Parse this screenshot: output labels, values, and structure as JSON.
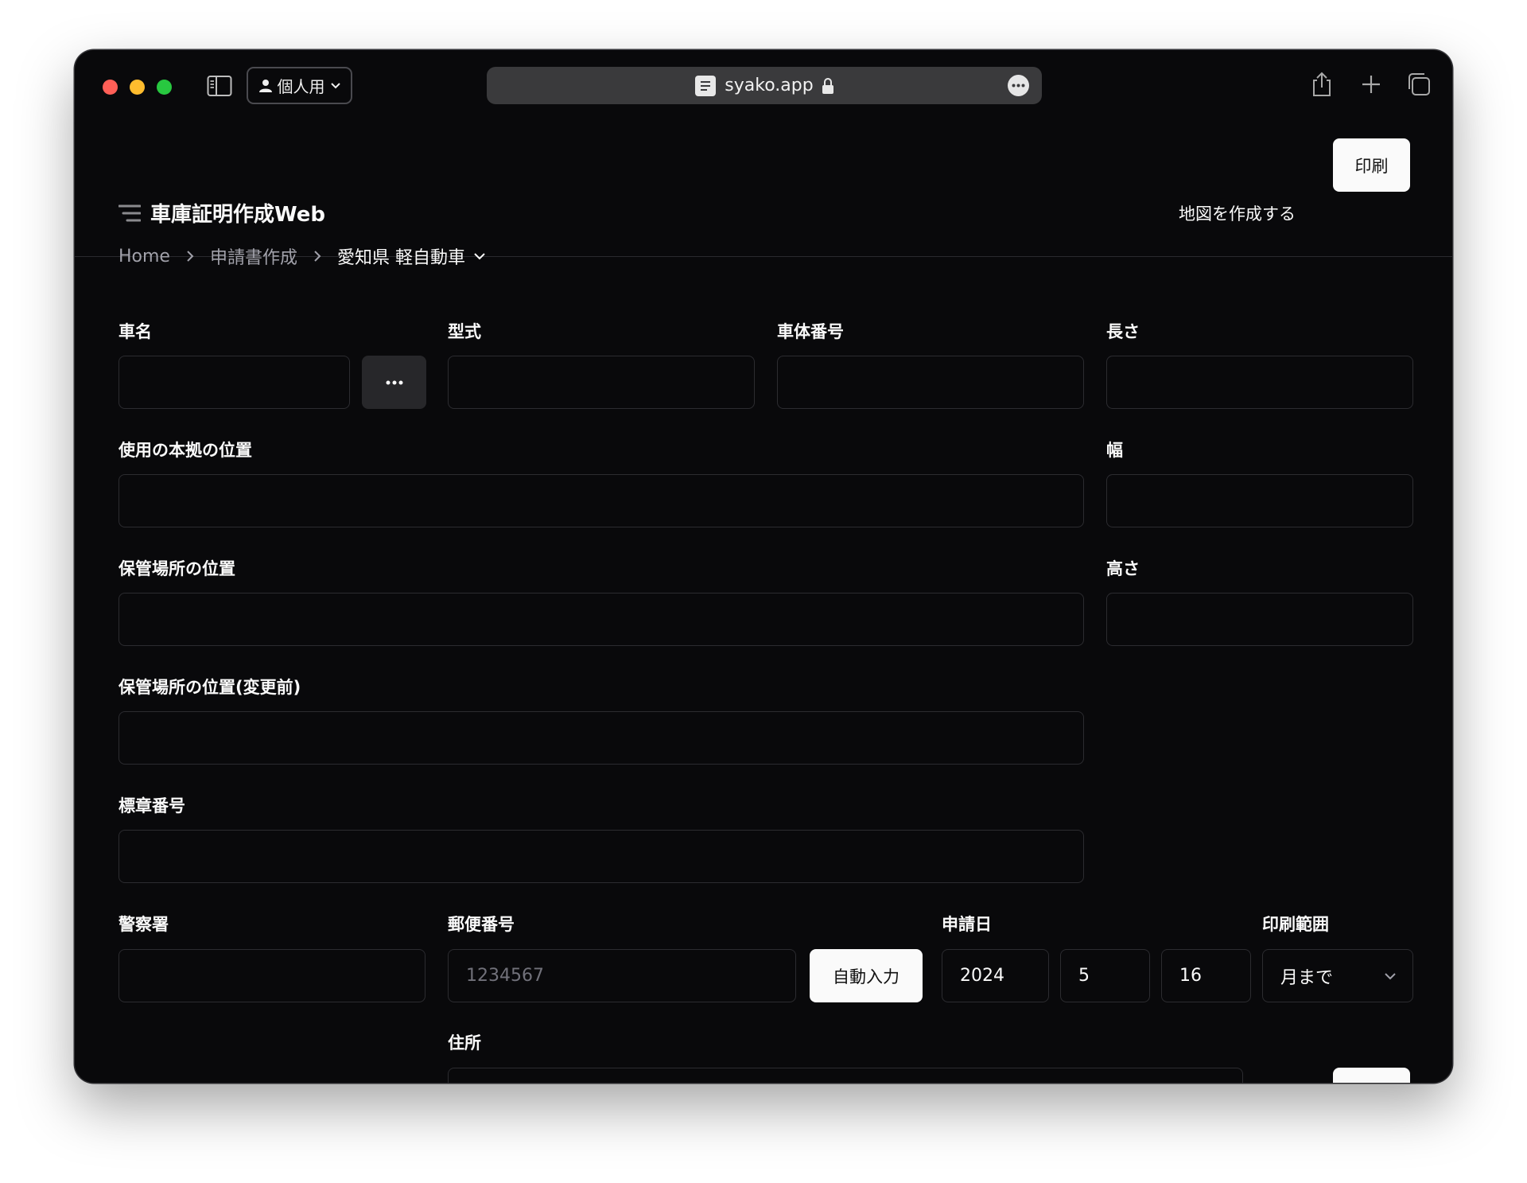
{
  "browser": {
    "profile_label": "個人用",
    "url": "syako.app"
  },
  "header": {
    "title": "車庫証明作成Web",
    "map_link": "地図を作成する",
    "print_button": "印刷"
  },
  "breadcrumb": {
    "home": "Home",
    "step": "申請書作成",
    "current": "愛知県 軽自動車"
  },
  "form": {
    "car_name": {
      "label": "車名",
      "value": ""
    },
    "model": {
      "label": "型式",
      "value": ""
    },
    "chassis_number": {
      "label": "車体番号",
      "value": ""
    },
    "length": {
      "label": "長さ",
      "value": ""
    },
    "base_location": {
      "label": "使用の本拠の位置",
      "value": ""
    },
    "width": {
      "label": "幅",
      "value": ""
    },
    "storage_location": {
      "label": "保管場所の位置",
      "value": ""
    },
    "height": {
      "label": "高さ",
      "value": ""
    },
    "storage_location_before": {
      "label": "保管場所の位置(変更前)",
      "value": ""
    },
    "plate_number": {
      "label": "標章番号",
      "value": ""
    },
    "police_station": {
      "label": "警察署",
      "value": ""
    },
    "postal_code": {
      "label": "郵便番号",
      "placeholder": "1234567",
      "autofill_button": "自動入力"
    },
    "application_date": {
      "label": "申請日",
      "year": "2024",
      "month": "5",
      "day": "16"
    },
    "print_range": {
      "label": "印刷範囲",
      "selected": "月まで"
    },
    "address": {
      "label": "住所",
      "value": ""
    }
  },
  "colors": {
    "background": "#09090b",
    "field_border": "#2c2c30",
    "primary_button": "#fafafa",
    "muted_text": "#a1a1aa"
  }
}
